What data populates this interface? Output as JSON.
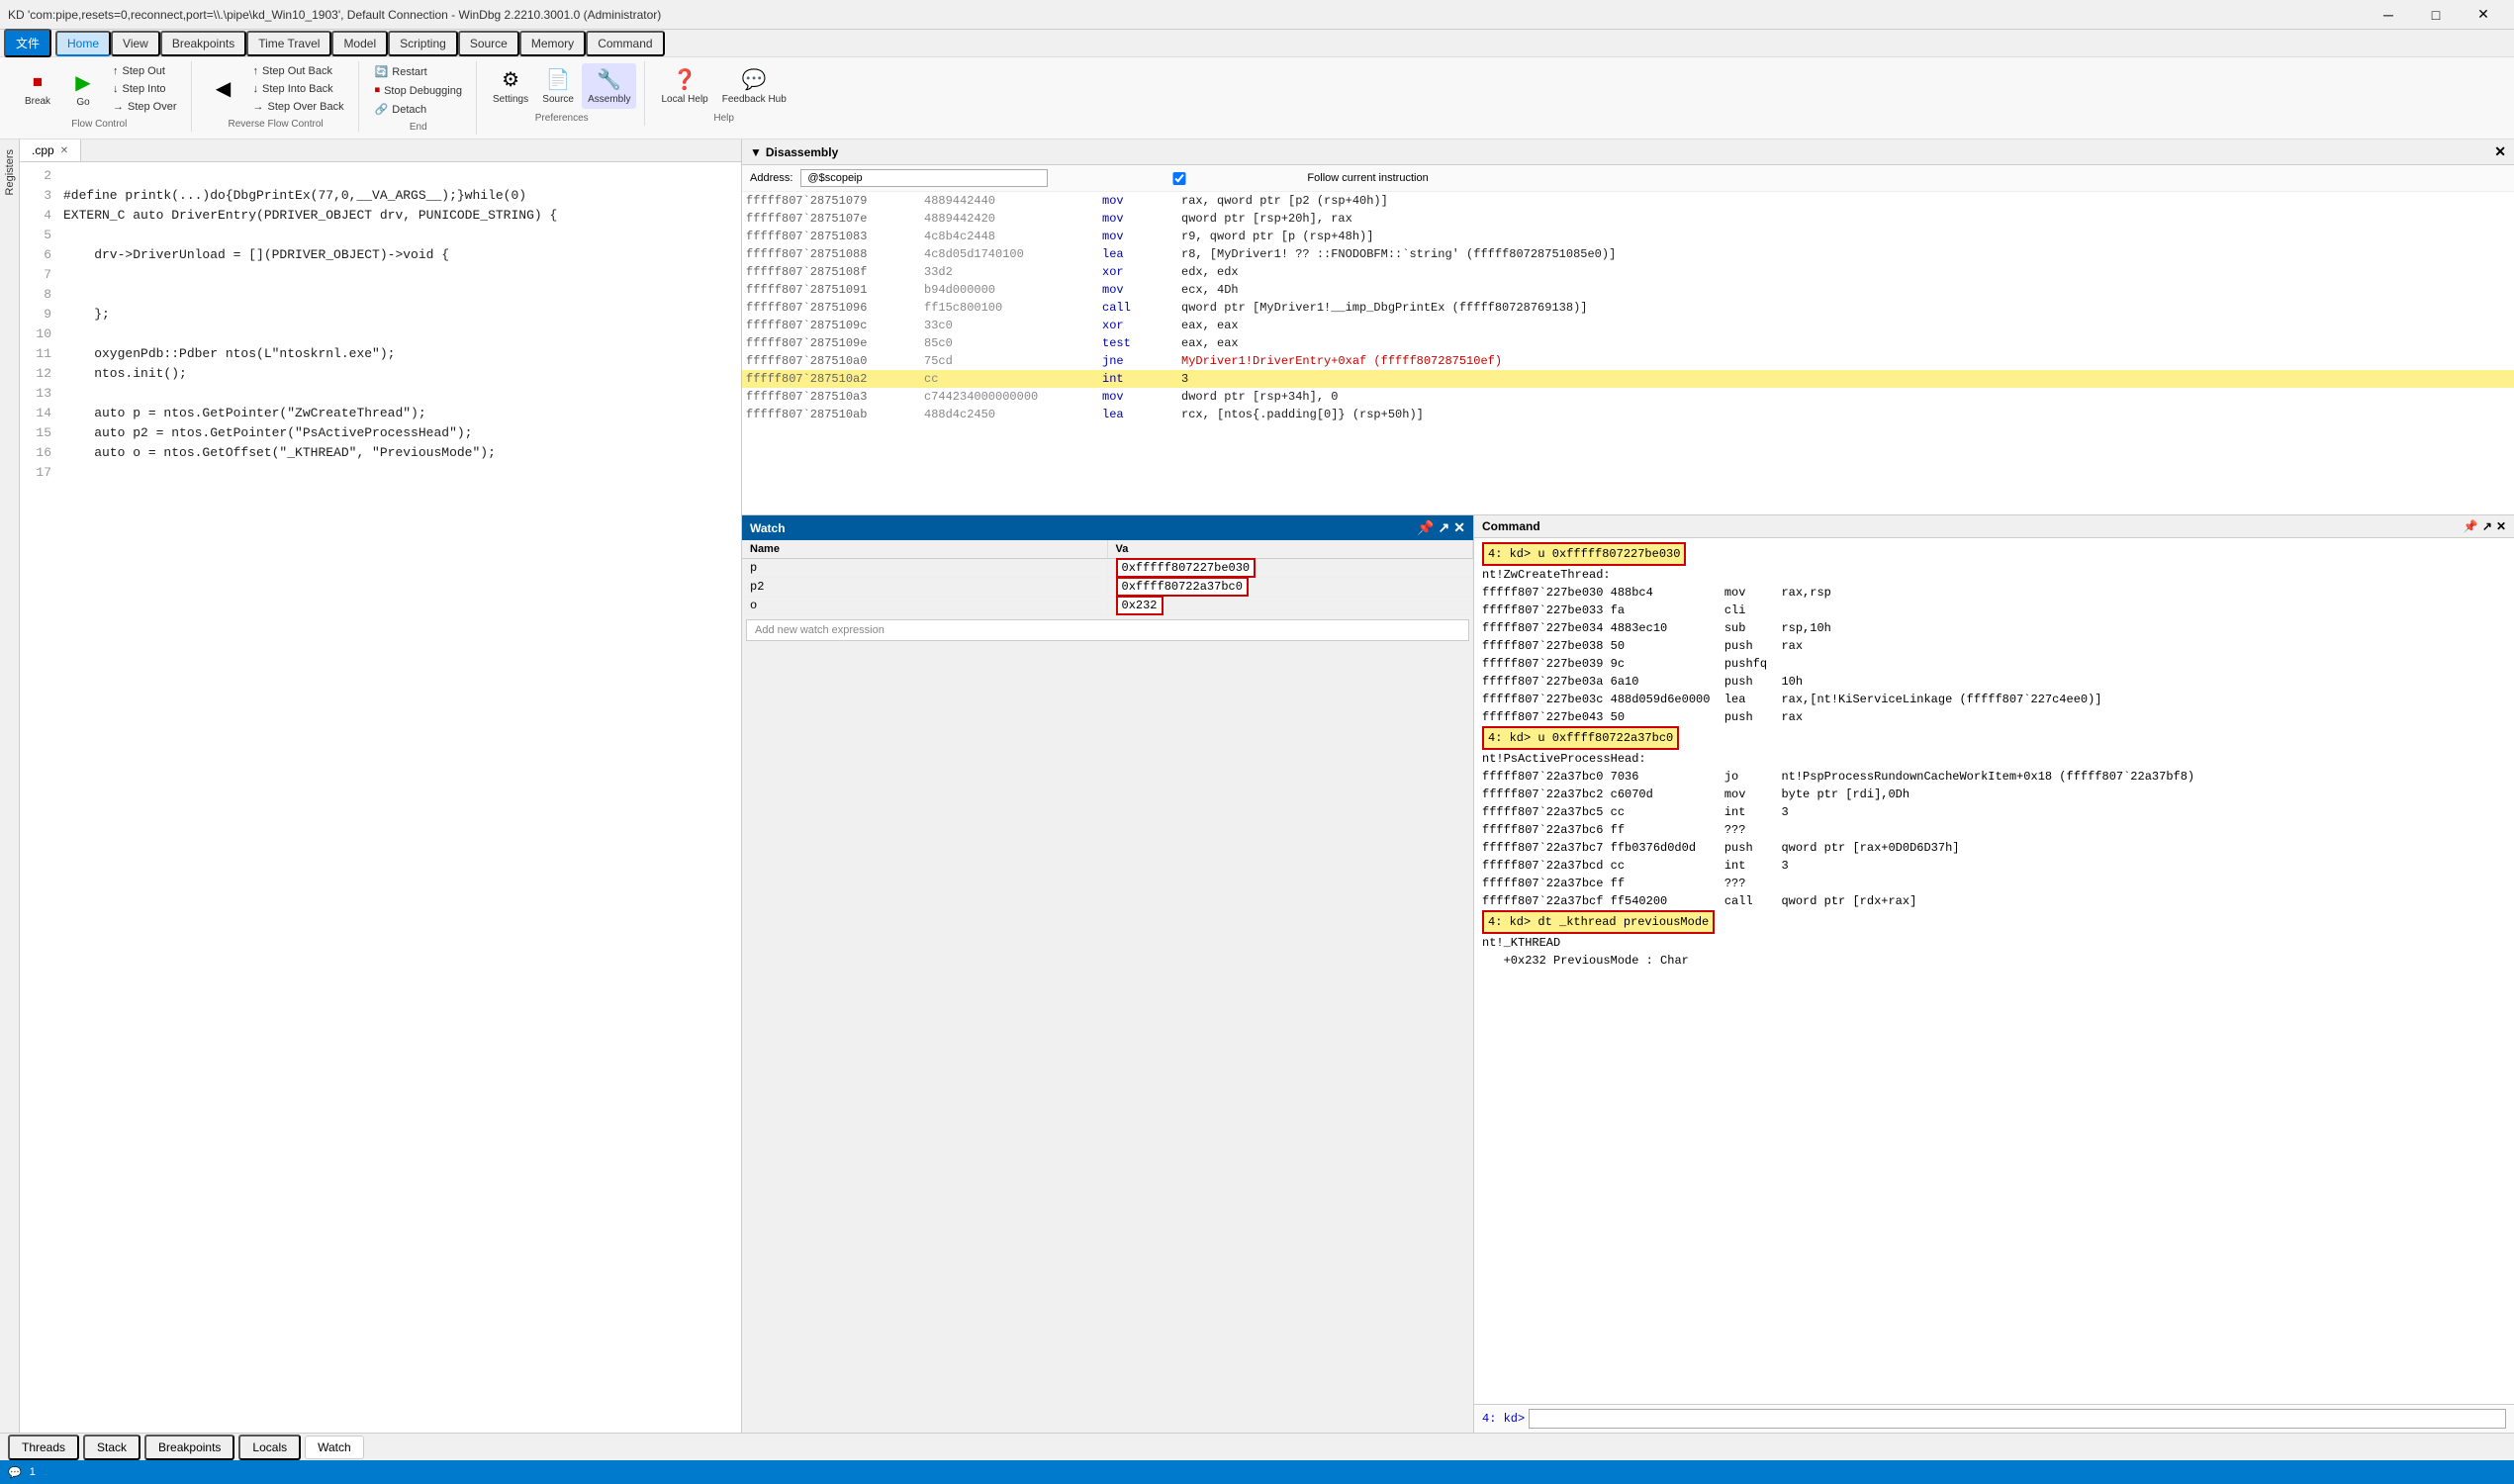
{
  "window": {
    "title": "KD 'com:pipe,resets=0,reconnect,port=\\\\.\\pipe\\kd_Win10_1903', Default Connection - WinDbg 2.2210.3001.0 (Administrator)",
    "min_btn": "─",
    "max_btn": "□",
    "close_btn": "✕"
  },
  "menubar": {
    "file": "文件",
    "home": "Home",
    "view": "View",
    "breakpoints": "Breakpoints",
    "time_travel": "Time Travel",
    "model": "Model",
    "scripting": "Scripting",
    "source": "Source",
    "memory": "Memory",
    "command": "Command"
  },
  "ribbon": {
    "break_label": "Break",
    "go_label": "Go",
    "step_out_label": "Step Out",
    "step_into_label": "Step Into",
    "step_over_label": "Step Over",
    "step_out_back_label": "Step Out Back",
    "step_into_back_label": "Step Into Back",
    "step_over_back_label": "Step Over Back",
    "restart_label": "Restart",
    "stop_debugging_label": "Stop Debugging",
    "detach_label": "Detach",
    "go_back_label": "Go Back",
    "flow_control_label": "Flow Control",
    "reverse_flow_label": "Reverse Flow Control",
    "end_label": "End",
    "settings_label": "Settings",
    "source_label": "Source",
    "assembly_label": "Assembly",
    "local_help_label": "Local Help",
    "feedback_hub_label": "Feedback Hub",
    "preferences_label": "Preferences",
    "help_label": "Help"
  },
  "editor": {
    "tab_name": ".cpp",
    "lines": [
      {
        "num": "2",
        "text": ""
      },
      {
        "num": "3",
        "text": "#define printk(...)do{DbgPrintEx(77,0,__VA_ARGS__);}while(0)",
        "type": "macro"
      },
      {
        "num": "4",
        "text": "EXTERN_C auto DriverEntry(PDRIVER_OBJECT drv, PUNICODE_STRING) {",
        "type": "keyword"
      },
      {
        "num": "5",
        "text": ""
      },
      {
        "num": "6",
        "text": "    drv->DriverUnload = [](PDRIVER_OBJECT)->void {",
        "type": "normal"
      },
      {
        "num": "7",
        "text": ""
      },
      {
        "num": "8",
        "text": ""
      },
      {
        "num": "9",
        "text": "    };",
        "type": "normal"
      },
      {
        "num": "10",
        "text": ""
      },
      {
        "num": "11",
        "text": "    oxygenPdb::Pdber ntos(L\"ntoskrnl.exe\");",
        "type": "normal"
      },
      {
        "num": "12",
        "text": "    ntos.init();",
        "type": "normal"
      },
      {
        "num": "13",
        "text": ""
      },
      {
        "num": "14",
        "text": "    auto p = ntos.GetPointer(\"ZwCreateThread\");",
        "type": "normal"
      },
      {
        "num": "15",
        "text": "    auto p2 = ntos.GetPointer(\"PsActiveProcessHead\");",
        "type": "normal"
      },
      {
        "num": "16",
        "text": "    auto o = ntos.GetOffset(\"_KTHREAD\", \"PreviousMode\");",
        "type": "normal"
      },
      {
        "num": "17",
        "text": ""
      }
    ]
  },
  "disassembly": {
    "title": "Disassembly",
    "address_label": "Address:",
    "address_value": "@$scopeip",
    "follow_label": "Follow current instruction",
    "lines": [
      {
        "addr": "fffff807`28751079",
        "bytes": "4889442440",
        "mnem": "mov",
        "ops": "rax, qword ptr [p2 (rsp+40h)]"
      },
      {
        "addr": "fffff807`2875107e",
        "bytes": "4889442420",
        "mnem": "mov",
        "ops": "qword ptr [rsp+20h], rax"
      },
      {
        "addr": "fffff807`28751083",
        "bytes": "4c8b4c2448",
        "mnem": "mov",
        "ops": "r9, qword ptr [p (rsp+48h)]"
      },
      {
        "addr": "fffff807`28751088",
        "bytes": "4c8d05d1740100",
        "mnem": "lea",
        "ops": "r8, [MyDriver1! ?? ::FNODOBFM::`string' (fffff80728751085e0)]"
      },
      {
        "addr": "fffff807`2875108f",
        "bytes": "33d2",
        "mnem": "xor",
        "ops": "edx, edx"
      },
      {
        "addr": "fffff807`28751091",
        "bytes": "b94d000000",
        "mnem": "mov",
        "ops": "ecx, 4Dh"
      },
      {
        "addr": "fffff807`28751096",
        "bytes": "ff15c800100",
        "mnem": "call",
        "ops": "qword ptr [MyDriver1!__imp_DbgPrintEx (fffff80728769138)]"
      },
      {
        "addr": "fffff807`2875109c",
        "bytes": "33c0",
        "mnem": "xor",
        "ops": "eax, eax"
      },
      {
        "addr": "fffff807`2875109e",
        "bytes": "85c0",
        "mnem": "test",
        "ops": "eax, eax"
      },
      {
        "addr": "fffff807`287510a0",
        "bytes": "75cd",
        "mnem": "jne",
        "ops": "MyDriver1!DriverEntry+0xaf (fffff807287510ef)",
        "highlight": true
      },
      {
        "addr": "fffff807`287510a2",
        "bytes": "cc",
        "mnem": "int",
        "ops": "3",
        "current": true
      },
      {
        "addr": "fffff807`287510a3",
        "bytes": "c744234000000000",
        "mnem": "mov",
        "ops": "dword ptr [rsp+34h], 0"
      },
      {
        "addr": "fffff807`287510ab",
        "bytes": "488d4c2450",
        "mnem": "lea",
        "ops": "rcx, [ntos{.padding[0]} (rsp+50h)]"
      }
    ]
  },
  "watch": {
    "title": "Watch",
    "col_name": "Name",
    "col_value": "Va",
    "rows": [
      {
        "name": "p",
        "value": "0xfffff807227be030"
      },
      {
        "name": "p2",
        "value": "0xffff80722a37bc0"
      },
      {
        "name": "o",
        "value": "0x232"
      }
    ],
    "add_expression": "Add new watch expression"
  },
  "command": {
    "title": "Command",
    "lines": [
      {
        "text": "4: kd> u 0xfffff807227be030",
        "type": "prompt"
      },
      {
        "text": "nt!ZwCreateThread:"
      },
      {
        "text": "fffff807`227be030 488bc4          mov     rax,rsp"
      },
      {
        "text": "fffff807`227be033 fa              cli"
      },
      {
        "text": "fffff807`227be034 4883ec10        sub     rsp,10h"
      },
      {
        "text": "fffff807`227be038 50              push    rax"
      },
      {
        "text": "fffff807`227be039 9c              pushfq"
      },
      {
        "text": "fffff807`227be03a 6a10            push    10h"
      },
      {
        "text": "fffff807`227be03c 488d059d6e0000  lea     rax,[nt!KiServiceLinkage (fffff807`227c4ee0)]"
      },
      {
        "text": "fffff807`227be043 50              push    rax"
      },
      {
        "text": "4: kd> u 0xffff80722a37bc0",
        "type": "prompt"
      },
      {
        "text": "nt!PsActiveProcessHead:"
      },
      {
        "text": "fffff807`22a37bc0 7036            jo      nt!PspProcessRundownCacheWorkItem+0x18 (fffff807`22a37bf8)"
      },
      {
        "text": "fffff807`22a37bc2 c6070d          mov     byte ptr [rdi],0Dh"
      },
      {
        "text": "fffff807`22a37bc5 cc              int     3"
      },
      {
        "text": "fffff807`22a37bc6 ff              ???"
      },
      {
        "text": "fffff807`22a37bc7 ffb0376d0d0d    push    qword ptr [rax+0D0D6D37h]"
      },
      {
        "text": "fffff807`22a37bcd cc              int     3"
      },
      {
        "text": "fffff807`22a37bce ff              ???"
      },
      {
        "text": "fffff807`22a37bcf ff540200        call    qword ptr [rdx+rax]"
      },
      {
        "text": "4: kd> dt _kthread previousMode",
        "type": "prompt"
      },
      {
        "text": "nt!_KTHREAD"
      },
      {
        "text": "   +0x232 PreviousMode : Char"
      }
    ],
    "input_prompt": "4: kd>",
    "input_value": ""
  },
  "bottom_tabs": {
    "tabs": [
      "Threads",
      "Stack",
      "Breakpoints",
      "Locals",
      "Watch"
    ]
  },
  "status": {
    "icon": "💬",
    "count": "1"
  }
}
